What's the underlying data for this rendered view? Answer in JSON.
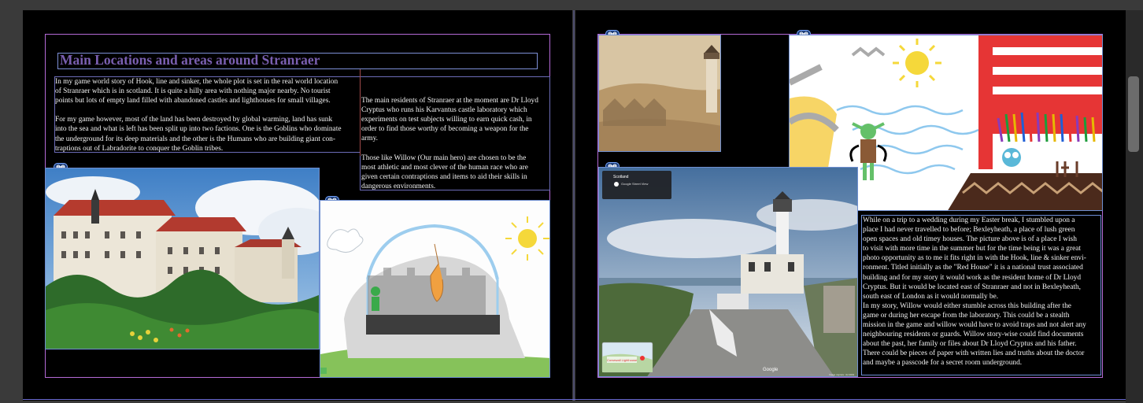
{
  "spread": {
    "left": {
      "title": "Main Locations and areas around Stranraer",
      "col1_text": "In my game world story of Hook, line and sinker, the whole plot is set in the real world location\nof Stranraer which is in scotland. It is quite a hilly area with nothing major nearby. No tourist\npoints but lots of empty land filled with abandoned castles and lighthouses for small villages.\n\nFor my game however, most of the land has been destroyed by global warming, land has sunk\ninto the sea and what is left has been split up into two factions. One is the Goblins who dominate\nthe underground for its deep materials and the other is the Humans who are building giant con-\ntraptions out of Labradorite to conquer the Goblin tribes.",
      "col2_text": "The main residents of Stranraer at the moment are Dr Lloyd\nCryptus who runs his Karvantus castle laboratory which\nexperiments on test subjects willing to earn quick cash, in\norder to find those worthy of becoming a weapon for the\narmy.\n\nThose like Willow (Our main hero) are chosen to be the\nmost athletic and most clever of the human race who are\ngiven certain contraptions and items to aid their skills in\ndangerous environments."
    },
    "right": {
      "body_text": "While on a trip to a wedding during my Easter break, I stumbled upon a\nplace I had never travelled to before; Bexleyheath, a place of lush green\nopen spaces and old timey houses. The picture above is of a place I wish\nto visit with more time in the summer but for the time being it was a great\nphoto opportunity as to me it fits right in with the Hook, line & sinker envi-\nronment. Titled initially as the \"Red House\" it is a national trust associated\nbuilding and for my story it would work as the resident home of Dr Lloyd\nCryptus. But it would be located east of Stranraer and not in Bexleyheath,\nsouth east of London as it would normally be.\nIn my story, Willow would either stumble across this building after the\ngame or during her escape from the laboratory. This could be a stealth\nmission in the game and willow would have to avoid traps and not alert any\nneighbouring residents or guards. Willow story-wise could find documents\nabout the past, her family or files about Dr Lloyd Cryptus and his father.\nThere could be pieces of paper with written lies and truths about the doctor\nand maybe a passcode for a secret room underground.",
      "streetview_location": "Scotland",
      "streetview_sub": "Google Street View",
      "minimap_label": "Corsewall Lighthouse",
      "google_label": "Google",
      "image_date": "Image capture: Jul 2019"
    }
  },
  "colors": {
    "frame": "#b46ad6",
    "text_frame": "#7d8fd6",
    "title": "#7a5fb0",
    "page": "#000000",
    "pasteboard": "#3a3a3a"
  }
}
